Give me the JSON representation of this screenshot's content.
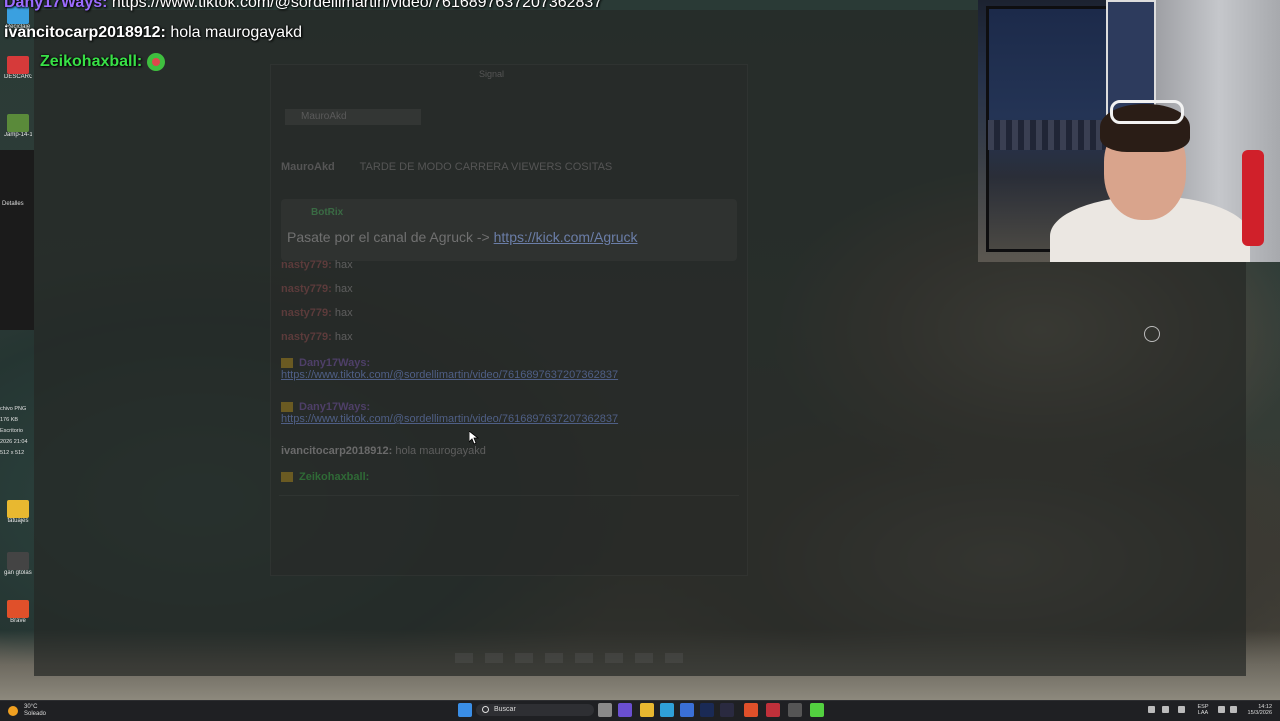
{
  "chat_overlay": {
    "line1": {
      "user": "Dany17Ways:",
      "text": "https://www.tiktok.com/@sordellimartin/video/7616897637207362837"
    },
    "line2": {
      "user": "ivancitocarp2018912:",
      "text": "hola maurogayakd"
    },
    "line3": {
      "user": "Zeikohaxball:",
      "emote": "emote-icon"
    }
  },
  "desktop": {
    "icons": [
      {
        "label": "Reciclaje",
        "icon": "recycle-bin-icon",
        "color": "#3aa0e0"
      },
      {
        "label": "DESCARGA",
        "icon": "folder-icon",
        "color": "#d63a3a"
      },
      {
        "label": "Jamp-14-1",
        "icon": "file-icon",
        "color": "#5a8a3a"
      },
      {
        "label": "tatuajes",
        "icon": "folder-icon",
        "color": "#e8b830"
      },
      {
        "label": "gan gtolas entrevistas",
        "icon": "video-icon",
        "color": "#444444"
      },
      {
        "label": "Brave",
        "icon": "brave-icon",
        "color": "#e0502a"
      }
    ],
    "side_panel_rows": [
      "Detalles"
    ],
    "file_info": [
      "chivo PNG",
      "176 KB",
      "Escritorio",
      "2026 21:04",
      "512 x 512"
    ]
  },
  "app_window": {
    "title": "Signal",
    "tab_label": "MauroAkd",
    "header_user": "MauroAkd",
    "header_title": "TARDE DE MODO CARRERA VIEWERS COSITAS",
    "pinned": {
      "author": "BotRix",
      "text": "Pasate por el canal de Agruck ->",
      "link": "https://kick.com/Agruck"
    },
    "messages": [
      {
        "user": "nasty779:",
        "text": "hax",
        "style": "red"
      },
      {
        "user": "nasty779:",
        "text": "hax",
        "style": "red"
      },
      {
        "user": "nasty779:",
        "text": "hax",
        "style": "red"
      },
      {
        "user": "nasty779:",
        "text": "hax",
        "style": "red"
      },
      {
        "user": "Dany17Ways:",
        "text": "",
        "style": "purple",
        "link": "https://www.tiktok.com/@sordellimartin/video/7616897637207362837"
      },
      {
        "user": "Dany17Ways:",
        "text": "",
        "style": "purple",
        "link": "https://www.tiktok.com/@sordellimartin/video/7616897637207362837"
      },
      {
        "user": "ivancitocarp2018912:",
        "text": "hola maurogayakd",
        "style": "grey"
      },
      {
        "user": "Zeikohaxball:",
        "text": "",
        "style": "green"
      }
    ]
  },
  "taskbar": {
    "weather_temp": "30°C",
    "weather_desc": "Soleado",
    "search_placeholder": "Buscar",
    "lang_line1": "ESP",
    "lang_line2": "LAA",
    "time": "14:12",
    "date": "15/3/2026"
  },
  "colors": {
    "taskbar_bg": "#1f2023",
    "chat_purple": "#9b6cff",
    "chat_green": "#38e046",
    "link": "#6b7ea8"
  }
}
